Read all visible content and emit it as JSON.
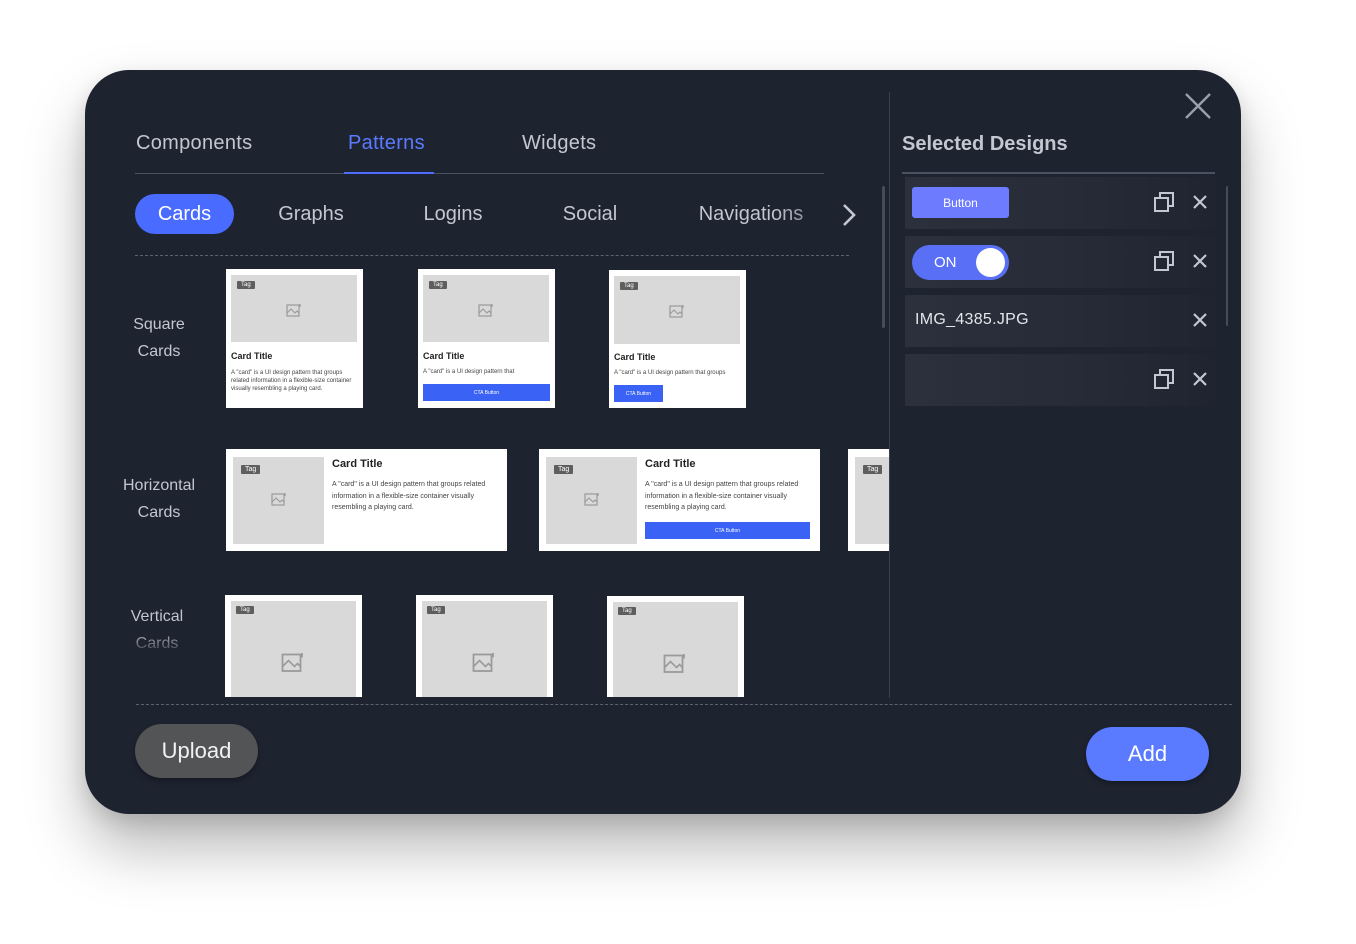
{
  "tabs": [
    {
      "label": "Components",
      "active": false
    },
    {
      "label": "Patterns",
      "active": true
    },
    {
      "label": "Widgets",
      "active": false
    }
  ],
  "categories": [
    {
      "label": "Cards",
      "active": true
    },
    {
      "label": "Graphs",
      "active": false
    },
    {
      "label": "Logins",
      "active": false
    },
    {
      "label": "Social",
      "active": false
    },
    {
      "label": "Navigations",
      "active": false
    }
  ],
  "rows": {
    "square": "Square\nCards",
    "horizontal": "Horizontal\nCards",
    "vertical": "Vertical\nCards"
  },
  "card": {
    "tag": "Tag",
    "title": "Card Title",
    "desc": "A \"card\" is a UI design pattern that groups related information in a flexible-size container visually resembling a playing card.",
    "desc_short": "A \"card\" is a UI design pattern that",
    "desc_mid": "A \"card\" is a UI design pattern that groups",
    "cta": "CTA Button"
  },
  "selected": {
    "title": "Selected Designs",
    "items": [
      {
        "type": "button",
        "label": "Button"
      },
      {
        "type": "toggle",
        "label": "ON",
        "state": "on"
      },
      {
        "type": "file",
        "label": "IMG_4385.JPG"
      },
      {
        "type": "empty",
        "label": ""
      }
    ]
  },
  "actions": {
    "upload": "Upload",
    "add": "Add"
  },
  "colors": {
    "background": "#1e2330",
    "accent": "#4a6bff",
    "upload": "#525456",
    "add": "#5a7bff"
  },
  "icons": [
    "close-icon",
    "chevron-right-icon",
    "duplicate-icon",
    "remove-icon",
    "image-placeholder-icon"
  ]
}
